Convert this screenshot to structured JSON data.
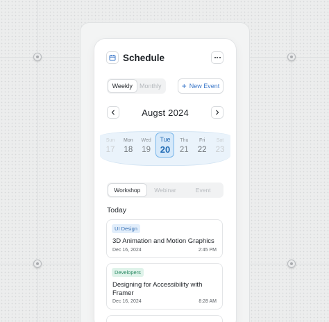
{
  "header": {
    "title": "Schedule",
    "calendar_icon": "calendar-icon",
    "more_icon": "more-horizontal-icon"
  },
  "view_toggle": {
    "options": [
      "Weekly",
      "Monthly"
    ],
    "selected": "Weekly"
  },
  "new_event": {
    "label": "New Event",
    "icon": "plus-icon"
  },
  "calendar": {
    "month_label": "Augst 2024",
    "days": [
      {
        "name": "Sun",
        "date": "17"
      },
      {
        "name": "Mon",
        "date": "18"
      },
      {
        "name": "Wed",
        "date": "19"
      },
      {
        "name": "Tue",
        "date": "20"
      },
      {
        "name": "Thu",
        "date": "21"
      },
      {
        "name": "Fri",
        "date": "22"
      },
      {
        "name": "Sat",
        "date": "23"
      }
    ],
    "selected_date": "20"
  },
  "category_tabs": {
    "items": [
      "Workshop",
      "Webinar",
      "Event"
    ],
    "selected": "Workshop"
  },
  "section_label": "Today",
  "events": [
    {
      "tag": "UI Design",
      "tag_color": "#e2eefb",
      "title": "3D Animation and Motion Graphics",
      "date": "Dec 16, 2024",
      "time": "2:45 PM"
    },
    {
      "tag": "Developers",
      "tag_color": "#dff3ea",
      "title": "Designing for Accessibility with Framer",
      "date": "Dec 16, 2024",
      "time": "8:28 AM"
    }
  ],
  "colors": {
    "accent": "#3a77c9",
    "selected_day_bg": "#d6e9fa",
    "week_band": "#eaf3fb"
  }
}
